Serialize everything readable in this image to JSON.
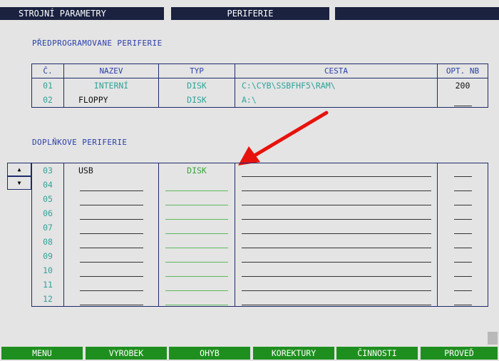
{
  "header": {
    "tab1": "STROJNÍ PARAMETRY",
    "tab2": "PERIFERIE",
    "tab3": ""
  },
  "predefined": {
    "title": "PŘEDPROGRAMOVANE PERIFERIE",
    "columns": [
      "Č.",
      "NAZEV",
      "TYP",
      "CESTA",
      "OPT. NB"
    ],
    "rows": [
      {
        "num": "01",
        "name": "INTERNÍ",
        "type": "DISK",
        "path": "C:\\CYB\\SSBFHF5\\RAM\\",
        "opt": "200"
      },
      {
        "num": "02",
        "name": "FLOPPY",
        "type": "DISK",
        "path": "A:\\",
        "opt": ""
      }
    ]
  },
  "additional": {
    "title": "DOPLŇKOVE PERIFERIE",
    "rows": [
      {
        "num": "03",
        "name": "USB",
        "type": "DISK"
      },
      {
        "num": "04",
        "name": "",
        "type": ""
      },
      {
        "num": "05",
        "name": "",
        "type": ""
      },
      {
        "num": "06",
        "name": "",
        "type": ""
      },
      {
        "num": "07",
        "name": "",
        "type": ""
      },
      {
        "num": "08",
        "name": "",
        "type": ""
      },
      {
        "num": "09",
        "name": "",
        "type": ""
      },
      {
        "num": "10",
        "name": "",
        "type": ""
      },
      {
        "num": "11",
        "name": "",
        "type": ""
      },
      {
        "num": "12",
        "name": "",
        "type": ""
      }
    ]
  },
  "icons": {
    "scroll_up": "up-triangle-icon",
    "scroll_down": "down-triangle-icon",
    "annotation": "red-arrow-icon"
  },
  "colors": {
    "tab_bg": "#1a2240",
    "softkey_bg": "#1e8f1e",
    "teal": "#2fa39a",
    "heading_blue": "#2a3fa8",
    "arrow_red": "#e8120c"
  },
  "softkeys": [
    "MENU",
    "VYROBEK",
    "OHYB",
    "KOREKTURY",
    "ČINNOSTI",
    "PROVEĎ"
  ]
}
